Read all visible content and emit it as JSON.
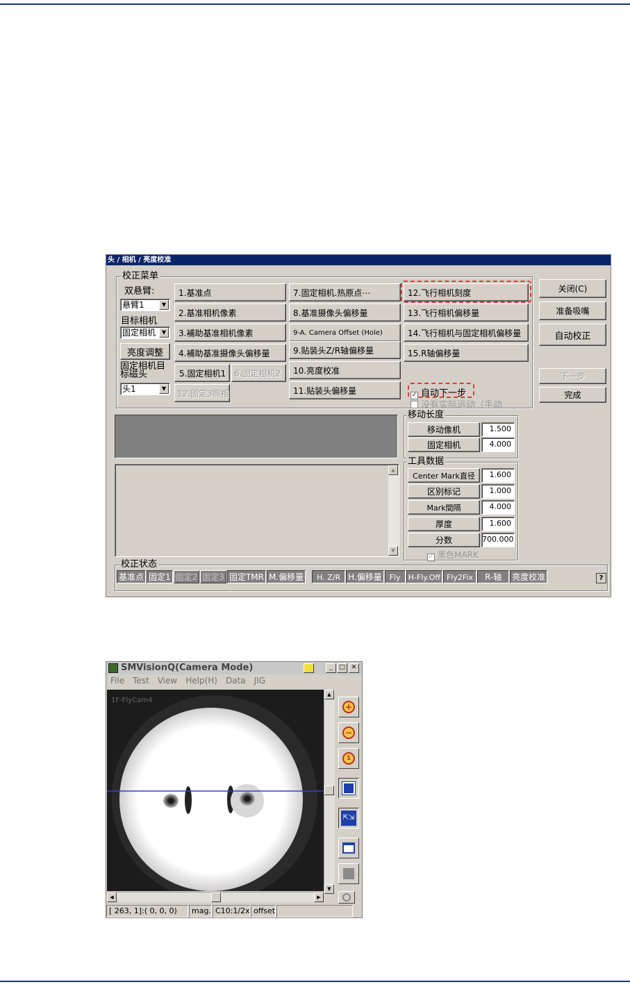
{
  "dialog": {
    "title": "头 / 相机 / 亮度校准",
    "menu_group_label": "校正菜单",
    "dual_arm_label": "双悬臂:",
    "dual_arm_value": "悬臂1",
    "target_camera_label": "目标相机",
    "target_camera_value": "固定相机",
    "brightness_adjust": "亮度调整",
    "fixed_camera_target_head_label": "固定相机目标磁头",
    "fixed_camera_target_head_value": "头1",
    "col1_buttons": [
      "1.基准点",
      "2.基准相机像素",
      "3.補助基准相机像素",
      "4.補助基准摄像头偏移量"
    ],
    "fixed_cam_1": "5.固定相机1",
    "fixed_cam_2": "6.固定相机2",
    "fixed_cam_3": "12.固定3照相",
    "col2_buttons": [
      "7.固定相机.热原点⋯",
      "8.基准摄像头偏移量",
      "9-A. Camera Offset (Hole)",
      "9.贴装头Z/R轴偏移量",
      "10.亮度校准",
      "11.贴装头偏移量"
    ],
    "col3_buttons": [
      "12.飞行相机刻度",
      "13.飞行相机偏移量",
      "14.飞行相机与固定相机偏移量",
      "15.R轴偏移量"
    ],
    "auto_next_label": "自动下一步",
    "auto_next_checked": true,
    "no_real_motion_label": "没有实际运动（手动",
    "close_button": "关闭(C)",
    "prepare_nozzle_button": "准备吸嘴",
    "auto_calibrate_button": "自动校正",
    "next_step_button": "下一步",
    "finish_button": "完成",
    "move_length": {
      "label": "移动长度",
      "rows": [
        {
          "label": "移动像机",
          "value": "1.500"
        },
        {
          "label": "固定相机",
          "value": "4.000"
        }
      ]
    },
    "tool_data": {
      "label": "工具数据",
      "rows": [
        {
          "label": "Center Mark直径",
          "value": "1.600"
        },
        {
          "label": "区别标记",
          "value": "1.000"
        },
        {
          "label": "Mark間隔",
          "value": "4.000"
        },
        {
          "label": "厚度",
          "value": "1.600"
        },
        {
          "label": "分数",
          "value": "700.000"
        }
      ],
      "black_mark_label": "黑色MARK"
    },
    "status": {
      "label": "校正状态",
      "items": [
        "基准点",
        "固定1",
        "固定2",
        "固定3",
        "固定TMR",
        "M.偏移量",
        "H. Z/R",
        "H.偏移量",
        "Fly",
        "H-Fly.Off",
        "Fly2Fix",
        "R-轴",
        "亮度校准"
      ],
      "help": "?"
    }
  },
  "vision": {
    "title": "SMVisionQ(Camera Mode)",
    "menu": [
      "File",
      "Test",
      "View",
      "Help(H)",
      "Data",
      "JIG"
    ],
    "camera_label": "1F-FlyCam4",
    "status_bar": [
      "[ 263,   1]:(  0,  0,  0)",
      "mag.",
      "C10:1/2x",
      "offset",
      ""
    ]
  }
}
